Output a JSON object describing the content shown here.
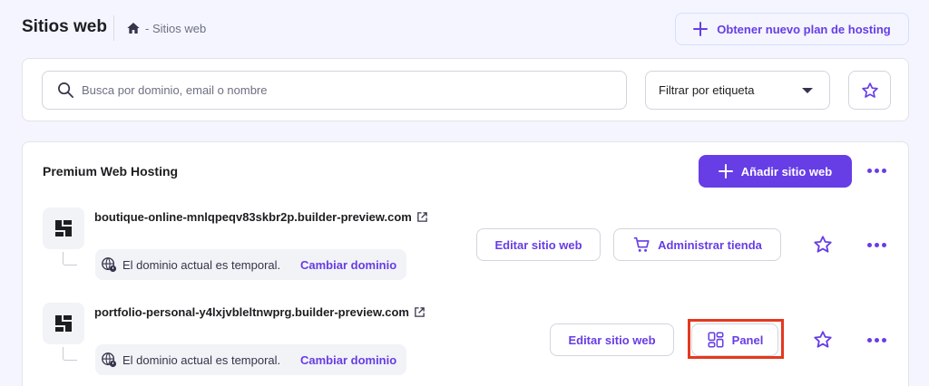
{
  "header": {
    "title": "Sitios web",
    "breadcrumb": "- Sitios web",
    "new_plan_label": "Obtener nuevo plan de hosting"
  },
  "filters": {
    "search_placeholder": "Busca por dominio, email o nombre",
    "tag_filter_label": "Filtrar por etiqueta"
  },
  "hosting": {
    "title": "Premium Web Hosting",
    "add_site_label": "Añadir sitio web",
    "sites": [
      {
        "domain": "boutique-online-mnlqpeqv83skbr2p.builder-preview.com",
        "temp_notice": "El dominio actual es temporal.",
        "change_domain_label": "Cambiar dominio",
        "edit_label": "Editar sitio web",
        "secondary_label": "Administrar tienda"
      },
      {
        "domain": "portfolio-personal-y4lxjvbleltnwprg.builder-preview.com",
        "temp_notice": "El dominio actual es temporal.",
        "change_domain_label": "Cambiar dominio",
        "edit_label": "Editar sitio web",
        "secondary_label": "Panel"
      }
    ]
  },
  "colors": {
    "accent": "#673de6",
    "background": "#f4f5ff",
    "highlight": "#e4381e"
  }
}
